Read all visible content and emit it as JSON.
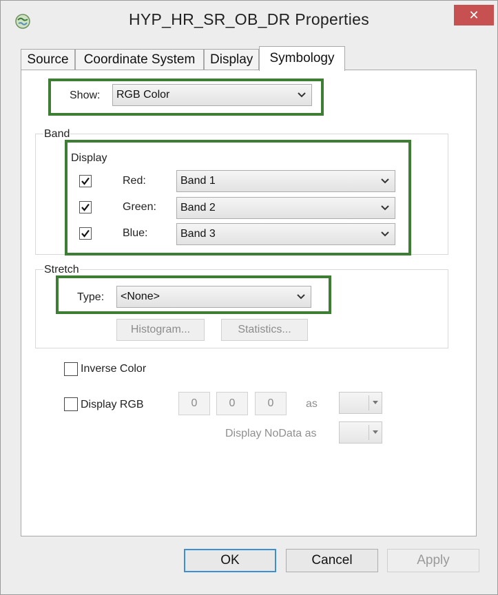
{
  "window": {
    "title": "HYP_HR_SR_OB_DR  Properties",
    "close_label": "✕"
  },
  "tabs": [
    {
      "label": "Source",
      "active": false
    },
    {
      "label": "Coordinate System",
      "active": false
    },
    {
      "label": "Display",
      "active": false
    },
    {
      "label": "Symbology",
      "active": true
    }
  ],
  "show": {
    "label": "Show:",
    "value": "RGB Color"
  },
  "band": {
    "group_label": "Band",
    "display_label": "Display",
    "rows": [
      {
        "label": "Red:",
        "value": "Band 1",
        "checked": true
      },
      {
        "label": "Green:",
        "value": "Band 2",
        "checked": true
      },
      {
        "label": "Blue:",
        "value": "Band 3",
        "checked": true
      }
    ]
  },
  "stretch": {
    "group_label": "Stretch",
    "type_label": "Type:",
    "type_value": "<None>",
    "histogram_button": "Histogram...",
    "statistics_button": "Statistics..."
  },
  "options": {
    "inverse_color_label": "Inverse Color",
    "inverse_color_checked": false,
    "display_rgb_label": "Display RGB",
    "display_rgb_checked": false,
    "rgb_values": [
      "0",
      "0",
      "0"
    ],
    "as_label": "as",
    "nodata_label": "Display NoData as"
  },
  "footer": {
    "ok": "OK",
    "cancel": "Cancel",
    "apply": "Apply"
  },
  "colors": {
    "highlight": "#3e7d34",
    "close": "#c75050",
    "default_border": "#3c8fd6"
  }
}
